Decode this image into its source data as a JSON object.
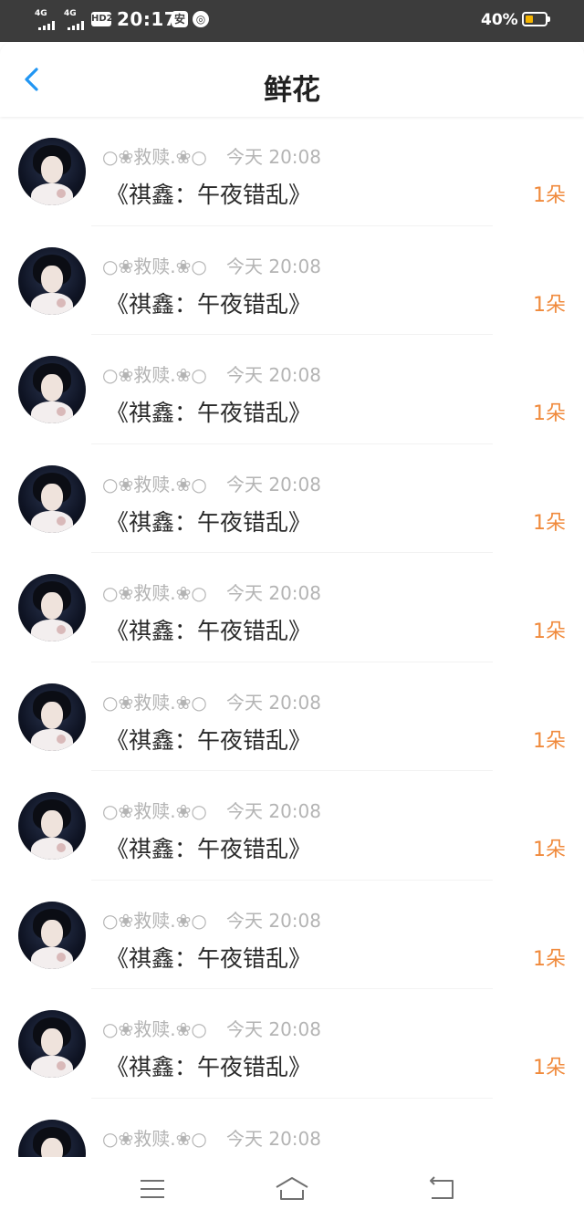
{
  "status_bar": {
    "network_1": "4G",
    "network_2": "4G",
    "hd_badge": "HD2",
    "time": "20:17",
    "app_icon_1": "安",
    "app_icon_2": "◎",
    "battery_percent": "40%",
    "battery_level": 0.4,
    "battery_color": "#f4b400"
  },
  "nav": {
    "back_icon": "chevron-left-icon",
    "title": "鲜花"
  },
  "colors": {
    "accent": "#2196f3",
    "count": "#f08a3c",
    "meta": "#b4b4b4"
  },
  "list": {
    "items": [
      {
        "user": "○❀救赎.❀○",
        "time": "今天 20:08",
        "gift": "《祺鑫：午夜错乱》",
        "count": "1朵"
      },
      {
        "user": "○❀救赎.❀○",
        "time": "今天 20:08",
        "gift": "《祺鑫：午夜错乱》",
        "count": "1朵"
      },
      {
        "user": "○❀救赎.❀○",
        "time": "今天 20:08",
        "gift": "《祺鑫：午夜错乱》",
        "count": "1朵"
      },
      {
        "user": "○❀救赎.❀○",
        "time": "今天 20:08",
        "gift": "《祺鑫：午夜错乱》",
        "count": "1朵"
      },
      {
        "user": "○❀救赎.❀○",
        "time": "今天 20:08",
        "gift": "《祺鑫：午夜错乱》",
        "count": "1朵"
      },
      {
        "user": "○❀救赎.❀○",
        "time": "今天 20:08",
        "gift": "《祺鑫：午夜错乱》",
        "count": "1朵"
      },
      {
        "user": "○❀救赎.❀○",
        "time": "今天 20:08",
        "gift": "《祺鑫：午夜错乱》",
        "count": "1朵"
      },
      {
        "user": "○❀救赎.❀○",
        "time": "今天 20:08",
        "gift": "《祺鑫：午夜错乱》",
        "count": "1朵"
      },
      {
        "user": "○❀救赎.❀○",
        "time": "今天 20:08",
        "gift": "《祺鑫：午夜错乱》",
        "count": "1朵"
      },
      {
        "user": "○❀救赎.❀○",
        "time": "今天 20:08",
        "gift": "",
        "count": ""
      }
    ]
  },
  "bottom_nav": {
    "items": [
      {
        "icon": "menu-icon"
      },
      {
        "icon": "home-icon"
      },
      {
        "icon": "back-icon"
      }
    ]
  }
}
